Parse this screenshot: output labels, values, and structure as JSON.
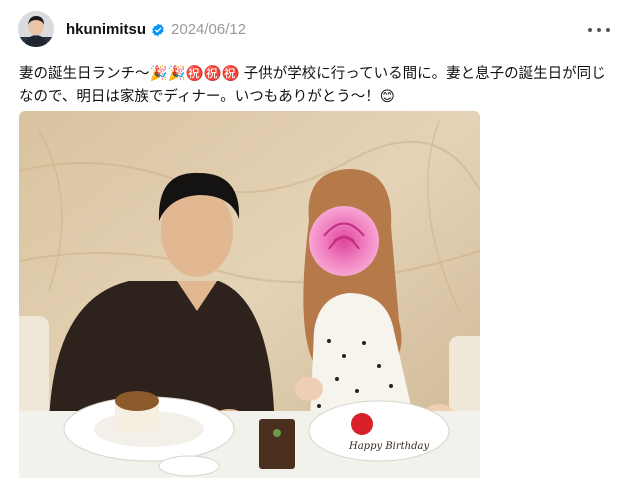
{
  "post": {
    "username": "hkunimitsu",
    "date": "2024/06/12",
    "caption": "妻の誕生日ランチ〜🎉🎉㊗️㊗️㊗️ 子供が学校に行っている間に。妻と息子の誕生日が同じなので、明日は家族でディナー。いつもありがとう〜！😊",
    "verified": true
  },
  "icons": {
    "avatar": "avatar-photo",
    "verified": "verified-badge-icon",
    "more": "more-options-icon"
  },
  "colors": {
    "verified_blue": "#0095f6",
    "date_gray": "#999999"
  },
  "photo": {
    "plate_text": "Happy Birthday"
  }
}
